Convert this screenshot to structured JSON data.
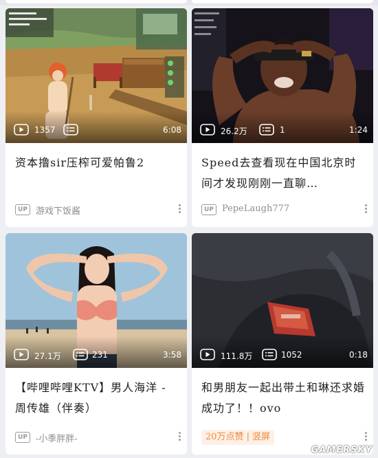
{
  "feed": {
    "cards": [
      {
        "views": "1357",
        "danmaku": "",
        "duration": "6:08",
        "title": "资本撸sir压榨可爱帕鲁2",
        "author": "游戏下饭酱",
        "up_badge": "UP"
      },
      {
        "views": "26.2万",
        "danmaku": "1",
        "duration": "1:24",
        "title": "Speed去查看现在中国北京时间才发现刚刚一直聊…",
        "author": "PepeLaugh777",
        "up_badge": "UP"
      },
      {
        "views": "27.1万",
        "danmaku": "231",
        "duration": "3:58",
        "title": "【哔哩哔哩KTV】男人海洋 - 周传雄（伴奏）",
        "author": "-小季胖胖-",
        "up_badge": "UP"
      },
      {
        "views": "111.8万",
        "danmaku": "1052",
        "duration": "0:18",
        "title": "和男朋友一起出带土和琳还求婚成功了！！ovo",
        "tag": "20万点赞 | 竖屏"
      }
    ]
  },
  "watermark": "GAMERSKY",
  "colors": {
    "background": "#eeeff2",
    "card": "#ffffff",
    "title_text": "#212121",
    "author_text": "#8d8d8d",
    "tag_bg": "#fdf0e6",
    "tag_text": "#f08a3c"
  },
  "icons": [
    "play-count-icon",
    "danmaku-icon",
    "up-badge-icon",
    "more-options-icon"
  ]
}
